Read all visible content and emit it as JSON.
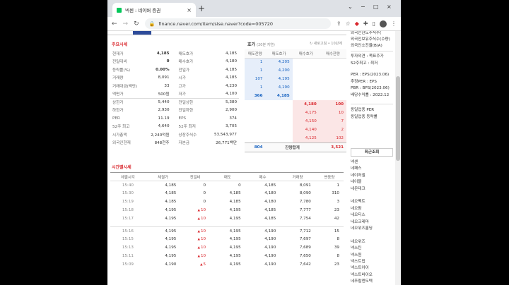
{
  "browser": {
    "tab_title": "넥센 : 네이버 증권",
    "tab_close": "×",
    "new_tab": "+",
    "url": "finance.naver.com/item/sise.naver?code=005720",
    "window_controls": [
      "⌄",
      "−",
      "□",
      "×"
    ]
  },
  "quote": {
    "title": "주요시세",
    "rows": [
      {
        "k": "현재가",
        "v": "4,185",
        "k2": "매도호가",
        "v2": "4,185",
        "vbold": true
      },
      {
        "k": "전일대비",
        "v": "0",
        "k2": "매수호가",
        "v2": "4,180",
        "vbold": true
      },
      {
        "k": "등락률(%)",
        "v": "0.00%",
        "k2": "전일가",
        "v2": "4,185",
        "vbold": true
      },
      {
        "k": "거래량",
        "v": "8,091",
        "k2": "시가",
        "v2": "4,185"
      },
      {
        "k": "거래대금(백만)",
        "v": "33",
        "k2": "고가",
        "v2": "4,230"
      },
      {
        "k": "액면가",
        "v": "500원",
        "k2": "저가",
        "v2": "4,100"
      },
      {
        "k": "상한가",
        "v": "5,440",
        "k2": "전일상한",
        "v2": "5,380",
        "sep": true
      },
      {
        "k": "하한가",
        "v": "2,930",
        "k2": "전일하한",
        "v2": "2,900"
      },
      {
        "k": "PER",
        "v": "11.19",
        "k2": "EPS",
        "v2": "374"
      },
      {
        "k": "52주 최고",
        "v": "4,640",
        "k2": "52주 최저",
        "v2": "3,705"
      },
      {
        "k": "시가총액",
        "v": "2,240억원",
        "k2": "상장주식수",
        "v2": "53,543,977"
      },
      {
        "k": "외국인현재",
        "v": "848천주",
        "k2": "자본금",
        "v2": "26,771백만"
      }
    ]
  },
  "hoga": {
    "title": "호가",
    "subtitle": "(20분 지연)",
    "refresh": "↻ 새로고침 • 10단계",
    "headers": [
      "매도잔량",
      "매도호가",
      "매수호가",
      "매수잔량"
    ],
    "asks": [
      {
        "qty": "1",
        "price": "4,205"
      },
      {
        "qty": "1",
        "price": "4,200"
      },
      {
        "qty": "107",
        "price": "4,195"
      },
      {
        "qty": "1",
        "price": "4,190"
      },
      {
        "qty": "366",
        "price": "4,185"
      }
    ],
    "bids": [
      {
        "price": "4,180",
        "qty": "100"
      },
      {
        "price": "4,175",
        "qty": "10"
      },
      {
        "price": "4,150",
        "qty": "7"
      },
      {
        "price": "4,140",
        "qty": "2"
      },
      {
        "price": "4,125",
        "qty": "102"
      }
    ],
    "total_ask": "804",
    "total_label": "잔량합계",
    "total_bid": "3,521"
  },
  "time": {
    "title": "시간별시세",
    "headers": [
      "체결시각",
      "체결가",
      "전일비",
      "매도",
      "매수",
      "거래량",
      "변동량"
    ],
    "groups": [
      [
        {
          "t": "15:40",
          "p": "4,185",
          "d": "0",
          "up": false,
          "s": "0",
          "b": "4,185",
          "vol": "8,091",
          "chg": "1"
        },
        {
          "t": "15:30",
          "p": "4,185",
          "d": "0",
          "up": false,
          "s": "4,185",
          "b": "4,180",
          "vol": "8,090",
          "chg": "310"
        },
        {
          "t": "15:19",
          "p": "4,185",
          "d": "0",
          "up": false,
          "s": "4,185",
          "b": "4,180",
          "vol": "7,780",
          "chg": "3"
        },
        {
          "t": "15:18",
          "p": "4,195",
          "d": "10",
          "up": true,
          "s": "4,195",
          "b": "4,185",
          "vol": "7,777",
          "chg": "23"
        },
        {
          "t": "15:17",
          "p": "4,195",
          "d": "10",
          "up": true,
          "s": "4,195",
          "b": "4,185",
          "vol": "7,754",
          "chg": "42"
        }
      ],
      [
        {
          "t": "15:16",
          "p": "4,195",
          "d": "10",
          "up": true,
          "s": "4,195",
          "b": "4,190",
          "vol": "7,712",
          "chg": "15"
        },
        {
          "t": "15:15",
          "p": "4,195",
          "d": "10",
          "up": true,
          "s": "4,195",
          "b": "4,190",
          "vol": "7,697",
          "chg": "8"
        },
        {
          "t": "15:13",
          "p": "4,195",
          "d": "10",
          "up": true,
          "s": "4,195",
          "b": "4,190",
          "vol": "7,689",
          "chg": "39"
        },
        {
          "t": "15:11",
          "p": "4,195",
          "d": "10",
          "up": true,
          "s": "4,195",
          "b": "4,190",
          "vol": "7,650",
          "chg": "8"
        },
        {
          "t": "15:09",
          "p": "4,190",
          "d": "5",
          "up": true,
          "s": "4,195",
          "b": "4,190",
          "vol": "7,642",
          "chg": "23"
        }
      ]
    ]
  },
  "side": {
    "top_lines": [
      "외국인한도주식수(",
      "외국인보유주식수(수량)",
      "외국인소진율(B/A)"
    ],
    "opinion_lines": [
      "투자의견 : 목표주가",
      "52주최고 : 최저"
    ],
    "per_lines": [
      "PER : EPS(2023.06)",
      "추정PER : EPS",
      "PBR : BPS(2023.06)",
      "배당수익률 : 2022.12"
    ],
    "industry_lines": [
      "동일업종 PER",
      "동일업종 등락률"
    ],
    "recent_title": "최근조회",
    "recent_lines": [
      "넥센",
      "네패스",
      "네이처셀",
      "네이블",
      "네온테크",
      "",
      "네오펙트",
      "네오팜",
      "네오티스",
      "네오크레마",
      "네오위즈홀딩",
      "",
      "네오위즈",
      "넥스틴",
      "넥스원",
      "넥스트칩",
      "넥스트아이",
      "넥스트바이오",
      "네추럴엔도텍"
    ]
  }
}
